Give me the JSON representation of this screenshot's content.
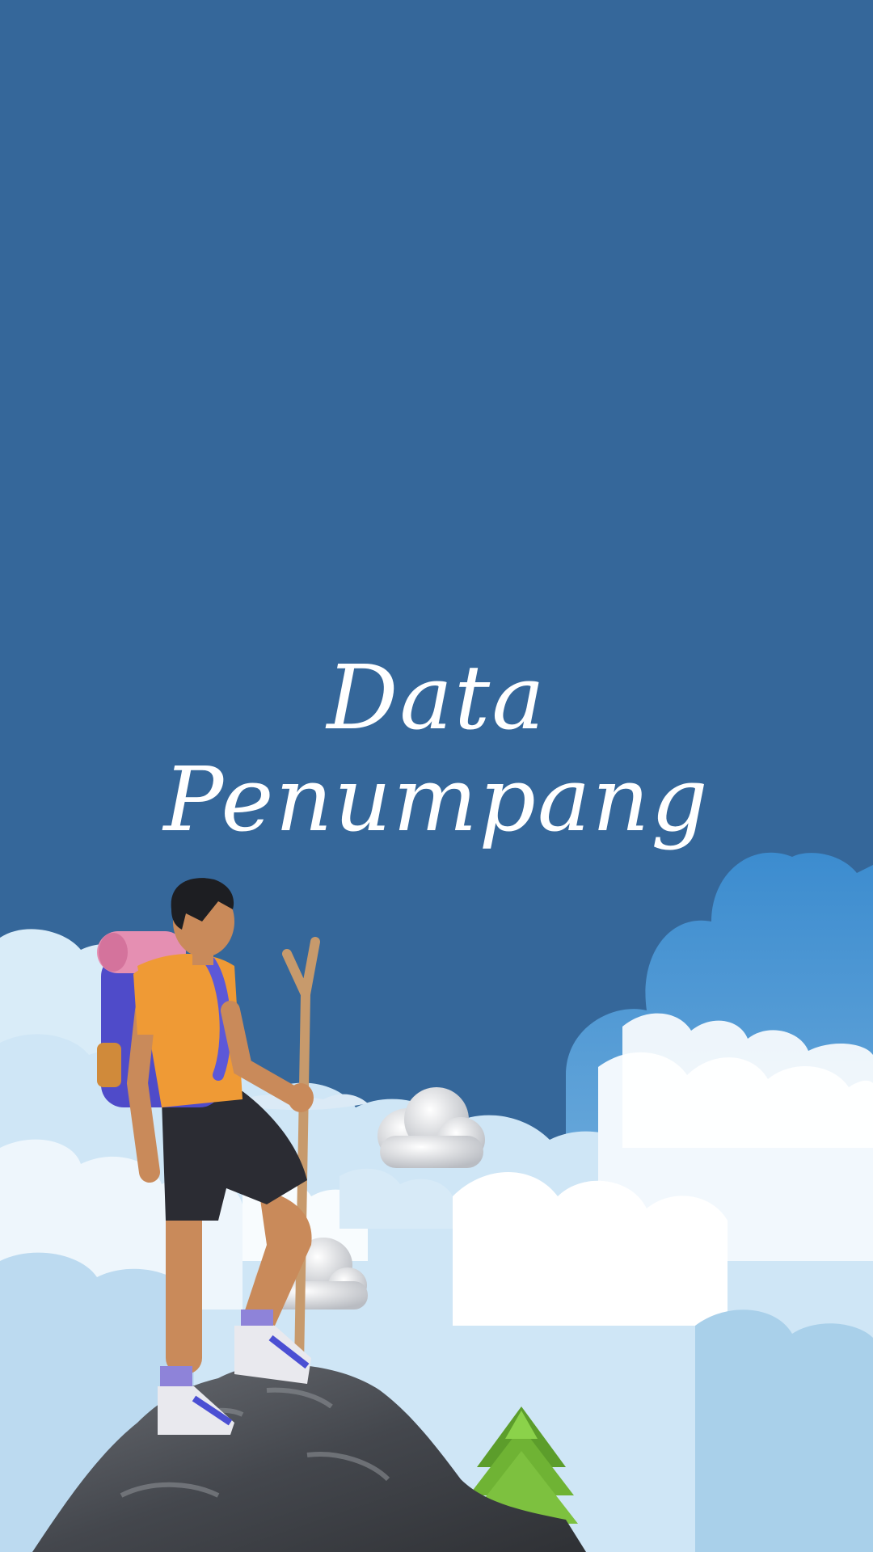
{
  "screen": {
    "background_color": "#35679a",
    "title_line1": "Data",
    "title_line2": "Penumpang"
  },
  "illustration": {
    "subject": "hiker-on-mountain-peak",
    "elements": [
      "hiker",
      "backpack",
      "bedroll",
      "walking-stick",
      "rock-peak",
      "pine-tree",
      "cloud-bank",
      "3d-clouds"
    ]
  }
}
